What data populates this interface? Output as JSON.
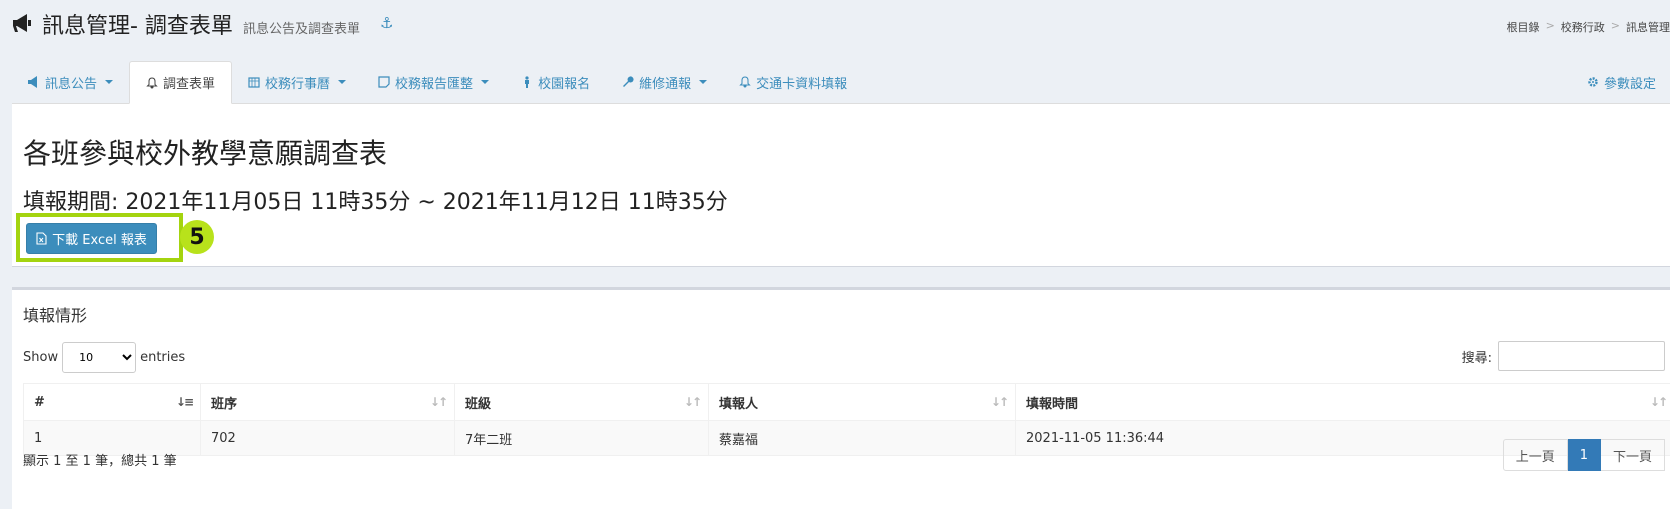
{
  "header": {
    "title": "訊息管理- 調查表單",
    "subtitle": "訊息公告及調查表單",
    "breadcrumb": [
      "根目錄",
      "校務行政",
      "訊息管理"
    ]
  },
  "tabs": [
    {
      "label": "訊息公告",
      "icon": "megaphone-icon",
      "dropdown": true
    },
    {
      "label": "調查表單",
      "icon": "bell-icon",
      "active": true
    },
    {
      "label": "校務行事曆",
      "icon": "calendar-icon",
      "dropdown": true
    },
    {
      "label": "校務報告匯整",
      "icon": "note-icon",
      "dropdown": true
    },
    {
      "label": "校園報名",
      "icon": "person-icon"
    },
    {
      "label": "維修通報",
      "icon": "wrench-icon",
      "dropdown": true
    },
    {
      "label": "交通卡資料填報",
      "icon": "bell-icon"
    },
    {
      "label": "參數設定",
      "icon": "gear-icon"
    }
  ],
  "survey": {
    "title": "各班參與校外教學意願調查表",
    "period": "填報期間: 2021年11月05日 11時35分 ~ 2021年11月12日 11時35分",
    "download_label": "下載 Excel 報表",
    "badge": "5"
  },
  "report": {
    "title": "填報情形",
    "show_label": "Show",
    "entries_label": "entries",
    "page_length": "10",
    "search_label": "搜尋:",
    "columns": [
      "#",
      "班序",
      "班級",
      "填報人",
      "填報時間"
    ],
    "rows": [
      [
        "1",
        "702",
        "7年二班",
        "蔡嘉福",
        "2021-11-05 11:36:44"
      ]
    ],
    "info": "顯示 1 至 1 筆，總共 1 筆",
    "prev": "上一頁",
    "page": "1",
    "next": "下一頁"
  },
  "colors": {
    "accent": "#3c8dbc",
    "highlight": "#a4d40f"
  }
}
